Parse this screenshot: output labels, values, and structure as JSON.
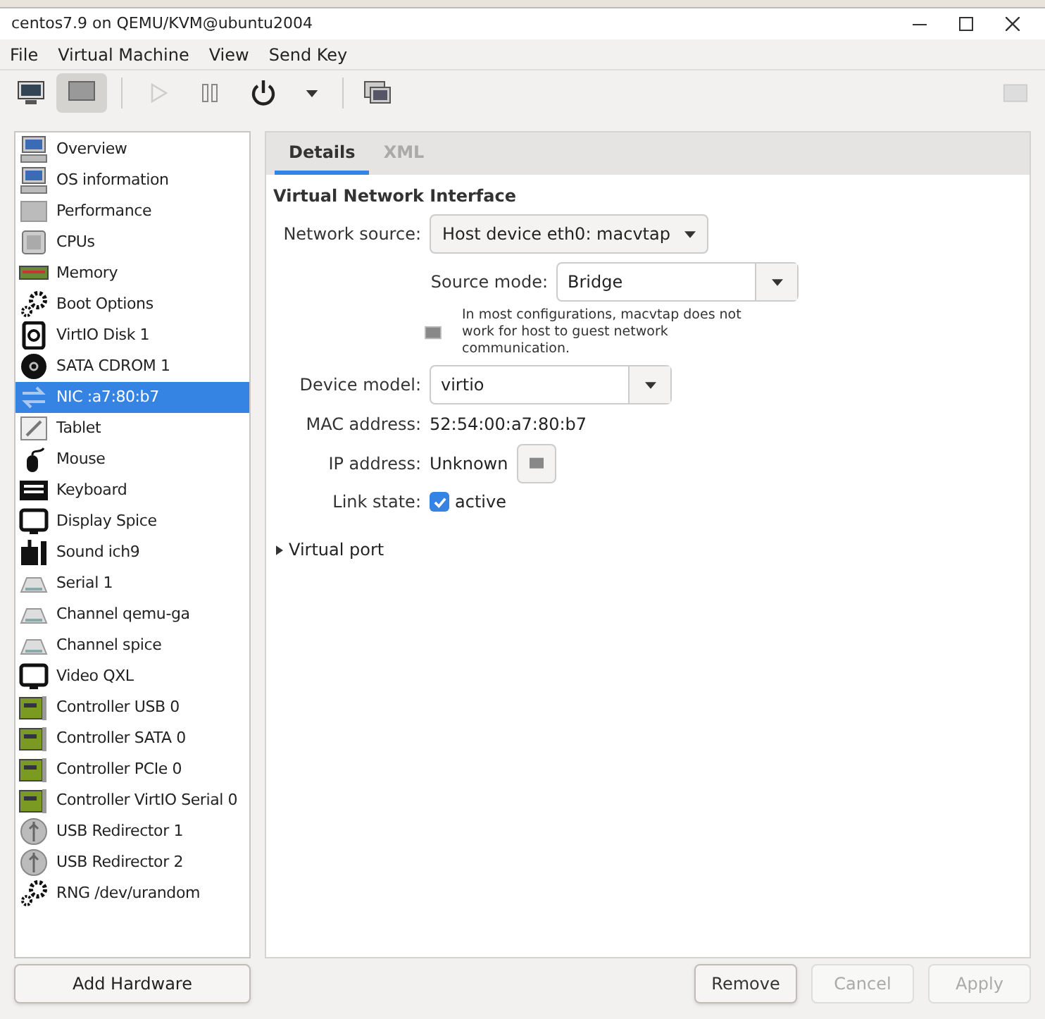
{
  "window": {
    "title": "centos7.9 on QEMU/KVM@ubuntu2004"
  },
  "menu": [
    "File",
    "Virtual Machine",
    "View",
    "Send Key"
  ],
  "toolbar": {
    "console_selected": false,
    "details_selected": true,
    "run_disabled": true,
    "pause_disabled": false
  },
  "sidebar": {
    "items": [
      {
        "label": "Overview",
        "kind": "monitor",
        "selected": false
      },
      {
        "label": "OS information",
        "kind": "monitor",
        "selected": false
      },
      {
        "label": "Performance",
        "kind": "panel",
        "selected": false
      },
      {
        "label": "CPUs",
        "kind": "chip",
        "selected": false
      },
      {
        "label": "Memory",
        "kind": "memory",
        "selected": false
      },
      {
        "label": "Boot Options",
        "kind": "gears",
        "selected": false
      },
      {
        "label": "VirtIO Disk 1",
        "kind": "disk",
        "selected": false
      },
      {
        "label": "SATA CDROM 1",
        "kind": "cdrom",
        "selected": false
      },
      {
        "label": "NIC :a7:80:b7",
        "kind": "nic",
        "selected": true
      },
      {
        "label": "Tablet",
        "kind": "tablet",
        "selected": false
      },
      {
        "label": "Mouse",
        "kind": "mouse",
        "selected": false
      },
      {
        "label": "Keyboard",
        "kind": "keyboard",
        "selected": false
      },
      {
        "label": "Display Spice",
        "kind": "display",
        "selected": false
      },
      {
        "label": "Sound ich9",
        "kind": "sound",
        "selected": false
      },
      {
        "label": "Serial 1",
        "kind": "serial",
        "selected": false
      },
      {
        "label": "Channel qemu-ga",
        "kind": "serial",
        "selected": false
      },
      {
        "label": "Channel spice",
        "kind": "serial",
        "selected": false
      },
      {
        "label": "Video QXL",
        "kind": "display",
        "selected": false
      },
      {
        "label": "Controller USB 0",
        "kind": "controller",
        "selected": false
      },
      {
        "label": "Controller SATA 0",
        "kind": "controller",
        "selected": false
      },
      {
        "label": "Controller PCIe 0",
        "kind": "controller",
        "selected": false
      },
      {
        "label": "Controller VirtIO Serial 0",
        "kind": "controller",
        "selected": false
      },
      {
        "label": "USB Redirector 1",
        "kind": "usb",
        "selected": false
      },
      {
        "label": "USB Redirector 2",
        "kind": "usb",
        "selected": false
      },
      {
        "label": "RNG /dev/urandom",
        "kind": "gears",
        "selected": false
      }
    ]
  },
  "add_hardware": "Add Hardware",
  "tabs": [
    {
      "label": "Details",
      "selected": true
    },
    {
      "label": "XML",
      "selected": false
    }
  ],
  "section_title": "Virtual Network Interface",
  "network_source": {
    "label": "Network source:",
    "value": "Host device eth0: macvtap"
  },
  "source_mode": {
    "label": "Source mode:",
    "value": "Bridge"
  },
  "warning": "In most configurations, macvtap does not work for host to guest network communication.",
  "device_model": {
    "label": "Device model:",
    "value": "virtio"
  },
  "mac_address": {
    "label": "MAC address:",
    "value": "52:54:00:a7:80:b7"
  },
  "ip_address": {
    "label": "IP address:",
    "value": "Unknown"
  },
  "link_state": {
    "label": "Link state:",
    "text": "active",
    "checked": true
  },
  "virtual_port": {
    "label": "Virtual port",
    "expanded": false
  },
  "buttons": [
    {
      "label": "Remove",
      "disabled": false
    },
    {
      "label": "Cancel",
      "disabled": true
    },
    {
      "label": "Apply",
      "disabled": true
    }
  ]
}
